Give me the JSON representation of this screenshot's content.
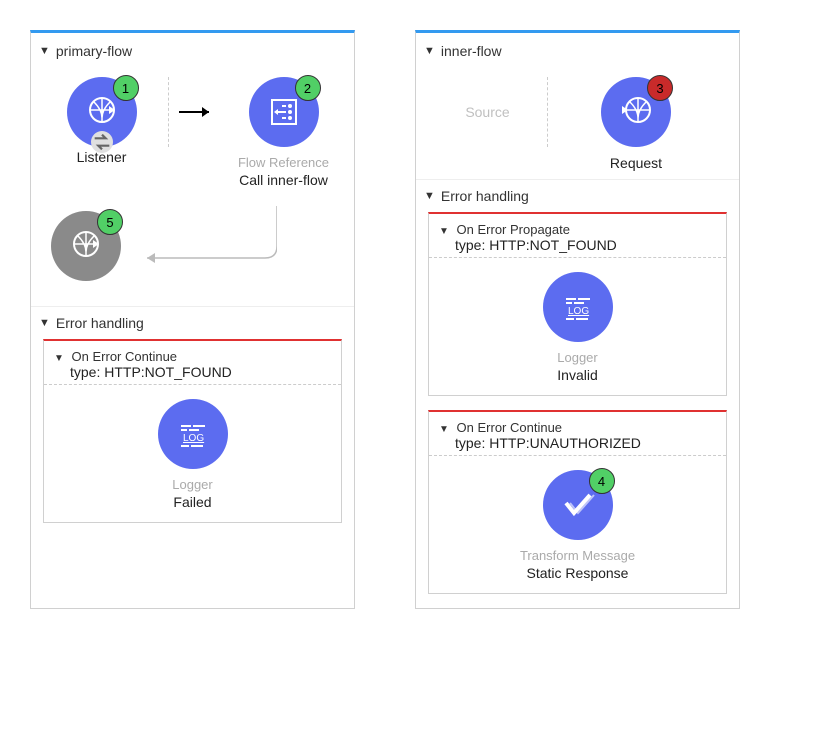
{
  "primary": {
    "title": "primary-flow",
    "listener": {
      "label": "Listener",
      "badge": "1"
    },
    "flowref": {
      "labelGray": "Flow Reference",
      "label": "Call inner-flow",
      "badge": "2"
    },
    "roundtrip": {
      "badge": "5"
    },
    "errorSection": "Error handling",
    "onErrorContinue": {
      "header": "On Error Continue",
      "type": "type: HTTP:NOT_FOUND",
      "loggerGray": "Logger",
      "loggerLabel": "Failed"
    }
  },
  "inner": {
    "title": "inner-flow",
    "sourcePlaceholder": "Source",
    "request": {
      "label": "Request",
      "badge": "3"
    },
    "errorSection": "Error handling",
    "onErrorPropagate": {
      "header": "On Error Propagate",
      "type": "type: HTTP:NOT_FOUND",
      "loggerGray": "Logger",
      "loggerLabel": "Invalid"
    },
    "onErrorContinue": {
      "header": "On Error Continue",
      "type": "type: HTTP:UNAUTHORIZED",
      "transformGray": "Transform Message",
      "transformLabel": "Static Response",
      "badge": "4"
    }
  }
}
